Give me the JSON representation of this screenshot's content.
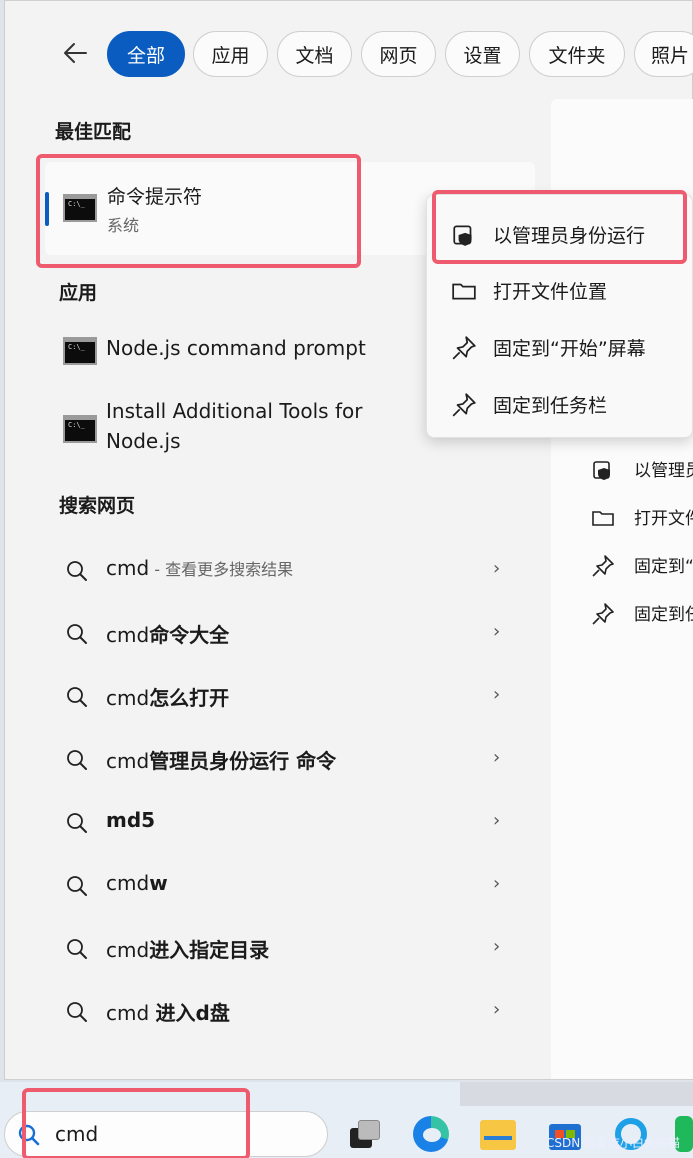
{
  "tabs": [
    "全部",
    "应用",
    "文档",
    "网页",
    "设置",
    "文件夹",
    "照片"
  ],
  "sections": {
    "best_match": "最佳匹配",
    "apps": "应用",
    "web": "搜索网页"
  },
  "best_match": {
    "title": "命令提示符",
    "subtitle": "系统"
  },
  "apps": [
    {
      "line1": "Node.js command prompt",
      "line2": ""
    },
    {
      "line1": "Install Additional Tools for",
      "line2": "Node.js"
    }
  ],
  "web_results": [
    {
      "term": "cmd",
      "bold": "",
      "suffix": " - 查看更多搜索结果"
    },
    {
      "term": "cmd",
      "bold": "命令大全",
      "suffix": ""
    },
    {
      "term": "cmd",
      "bold": "怎么打开",
      "suffix": ""
    },
    {
      "term": "cmd",
      "bold": "管理员身份运行 命令",
      "suffix": ""
    },
    {
      "term": "",
      "bold": "md5",
      "suffix": ""
    },
    {
      "term": "cmd",
      "bold": "w",
      "suffix": ""
    },
    {
      "term": "cmd",
      "bold": "进入指定目录",
      "suffix": ""
    },
    {
      "term": "cmd ",
      "bold": "进入d盘",
      "suffix": ""
    }
  ],
  "context_menu": [
    {
      "label": "以管理员身份运行",
      "icon": "shield-icon"
    },
    {
      "label": "打开文件位置",
      "icon": "folder-icon"
    },
    {
      "label": "固定到“开始”屏幕",
      "icon": "pin-icon"
    },
    {
      "label": "固定到任务栏",
      "icon": "pin-icon"
    }
  ],
  "right_pane_actions": [
    "以管理员",
    "打开文件",
    "固定到“开",
    "固定到任"
  ],
  "search": {
    "value": "cmd"
  },
  "watermark": "CSDN @爱吃小白兔的猫",
  "colors": {
    "accent": "#0b5cc0",
    "highlight": "#ef5b6e"
  }
}
